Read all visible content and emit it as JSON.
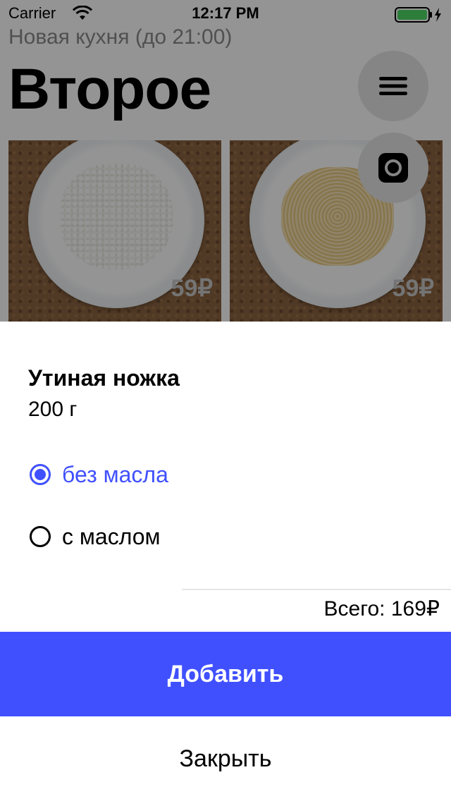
{
  "status_bar": {
    "carrier": "Carrier",
    "time": "12:17 PM",
    "icons": [
      "wifi-icon",
      "battery-icon",
      "charging-bolt-icon"
    ],
    "battery_color": "#4cd964"
  },
  "background_page": {
    "subtitle": "Новая кухня (до 21:00)",
    "title": "Второе",
    "menu_button_icon": "hamburger-menu-icon",
    "camera_button_icon": "instagram-camera-icon",
    "dishes": [
      {
        "image": "rice-plate",
        "price": "59₽"
      },
      {
        "image": "pasta-plate",
        "price": "59₽"
      }
    ]
  },
  "sheet": {
    "item_name": "Утиная ножка",
    "item_weight": "200 г",
    "options": [
      {
        "label": "без масла",
        "selected": true
      },
      {
        "label": "с маслом",
        "selected": false
      }
    ],
    "total": "Всего: 169₽",
    "add_label": "Добавить",
    "close_label": "Закрыть"
  },
  "colors": {
    "accent": "#4050ff",
    "overlay": "rgba(0,0,0,0.42)"
  }
}
